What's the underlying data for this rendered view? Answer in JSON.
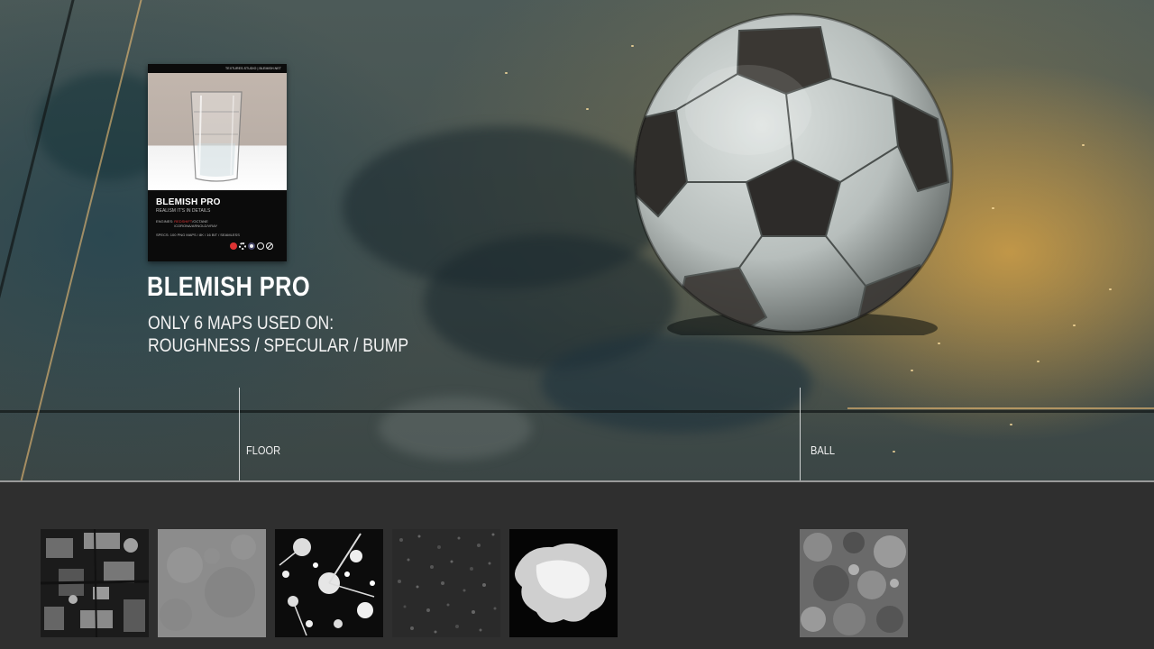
{
  "hero": {
    "title": "BLEMISH PRO",
    "subtitle_line1": "ONLY 6 MAPS USED ON:",
    "subtitle_line2": "ROUGHNESS / SPECULAR / BUMP"
  },
  "product_card": {
    "header": "TEXTURES.STUDIO | BLEMISH.NET",
    "title": "BLEMISH PRO",
    "tagline": "REALISM IT'S IN DETAILS",
    "engines_label": "ENGINES:",
    "engines_highlight": "REDSHIFT",
    "engines_rest": "/OCTANE",
    "engines_line2": "/CORONA/ARNOLD/VRAY",
    "specs_label": "SPECS:",
    "specs": "100 PNG MAPS / 8K / 16 BIT / SEAMLESS",
    "icons": [
      "redshift-logo-icon",
      "gear-logo-icon",
      "octane-logo-icon",
      "arnold-logo-icon",
      "vray-logo-icon"
    ]
  },
  "callouts": {
    "floor": "FLOOR",
    "ball": "BALL"
  },
  "maps": [
    {
      "name": "floor-map-1",
      "style": "dark-patchy-grunge"
    },
    {
      "name": "floor-map-2",
      "style": "gray-smudge"
    },
    {
      "name": "floor-map-3",
      "style": "white-splatter"
    },
    {
      "name": "floor-map-4",
      "style": "fine-noise"
    },
    {
      "name": "floor-map-5",
      "style": "white-blob"
    },
    {
      "name": "ball-map-1",
      "style": "gray-blotches"
    }
  ],
  "colors": {
    "strip_background": "#2f2f2f",
    "divider": "#9a9a9a",
    "text": "#ffffff",
    "accent_red": "#dd3333"
  }
}
